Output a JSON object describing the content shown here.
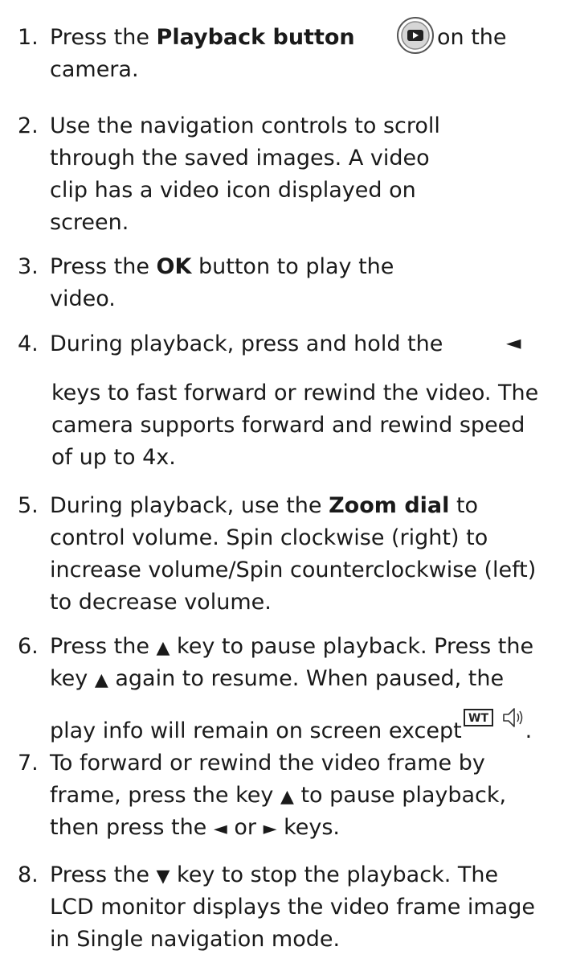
{
  "steps": [
    {
      "num": "1.",
      "l1a": "Press the ",
      "l1b": "Playback button",
      "l1c": "on the",
      "l2": "camera."
    },
    {
      "num": "2.",
      "l1": "Use the navigation controls to scroll",
      "l2": "through the saved images. A video",
      "l3": "clip has a video icon displayed on",
      "l4": "screen."
    },
    {
      "num": "3.",
      "l1a": "Press the ",
      "l1b": "OK",
      "l1c": " button to play the",
      "l2": "video."
    },
    {
      "num": "4.",
      "l1": "During playback, press and hold the",
      "l2": "keys to fast forward or rewind the video. The",
      "l3": "camera supports forward and rewind speed",
      "l4": "of up to 4x."
    },
    {
      "num": "5.",
      "l1a": "During playback, use the ",
      "l1b": "Zoom dial",
      "l1c": " to",
      "l2": "control volume. Spin clockwise (right) to",
      "l3": "increase volume/Spin counterclockwise (left)",
      "l4": "to decrease volume."
    },
    {
      "num": "6.",
      "l1a": "Press the ",
      "l1c": " key to pause playback. Press the",
      "l2a": "key ",
      "l2c": " again to resume. When paused, the",
      "l3a": "play info will remain on screen except",
      "l3c": ".",
      "wt_label": "WT"
    },
    {
      "num": "7.",
      "l1": "To forward or rewind the video frame by",
      "l2a": "frame, press the key ",
      "l2c": " to pause playback,",
      "l3a": "then press the ",
      "l3b": " or ",
      "l3c": " keys."
    },
    {
      "num": "8.",
      "l1a": "Press the ",
      "l1c": " key to stop the playback. The",
      "l2": "LCD monitor displays the video frame image",
      "l3": "in Single navigation mode."
    }
  ],
  "glyphs": {
    "up": "▲",
    "down": "▼",
    "left": "◄",
    "right": "►"
  },
  "icons": [
    "playback-button-icon",
    "wt-icon",
    "speaker-icon"
  ]
}
